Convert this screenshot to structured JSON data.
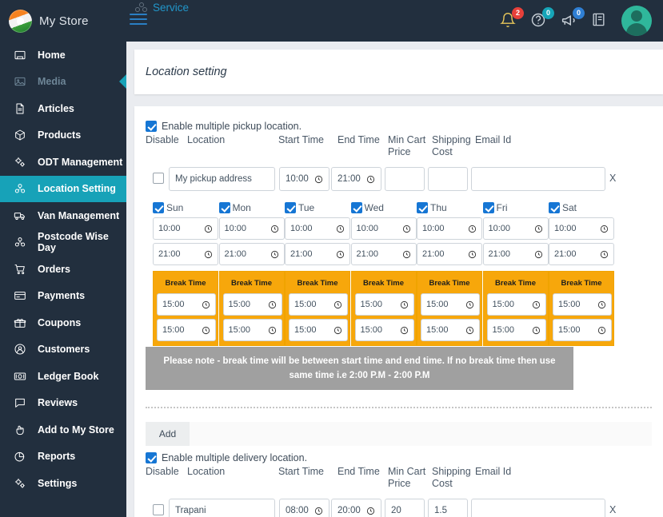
{
  "topbar": {
    "brand_name": "My Store",
    "service_tab": "Service",
    "notifications_badge": "2",
    "help_badge": "0",
    "announce_badge": "0"
  },
  "sidebar": {
    "items": [
      {
        "label": "Home",
        "icon": "home-icon",
        "state": "normal"
      },
      {
        "label": "Media",
        "icon": "media-icon",
        "state": "muted"
      },
      {
        "label": "Articles",
        "icon": "articles-icon",
        "state": "normal"
      },
      {
        "label": "Products",
        "icon": "products-icon",
        "state": "normal"
      },
      {
        "label": "ODT Management",
        "icon": "odt-icon",
        "state": "normal"
      },
      {
        "label": "Location Setting",
        "icon": "location-setting-icon",
        "state": "active"
      },
      {
        "label": "Van Management",
        "icon": "van-icon",
        "state": "normal"
      },
      {
        "label": "Postcode Wise Day",
        "icon": "postcode-icon",
        "state": "normal"
      },
      {
        "label": "Orders",
        "icon": "orders-icon",
        "state": "normal"
      },
      {
        "label": "Payments",
        "icon": "payments-icon",
        "state": "normal"
      },
      {
        "label": "Coupons",
        "icon": "coupons-icon",
        "state": "normal"
      },
      {
        "label": "Customers",
        "icon": "customers-icon",
        "state": "normal"
      },
      {
        "label": "Ledger Book",
        "icon": "ledger-icon",
        "state": "normal"
      },
      {
        "label": "Reviews",
        "icon": "reviews-icon",
        "state": "normal"
      },
      {
        "label": "Add to My Store",
        "icon": "add-to-store-icon",
        "state": "normal"
      },
      {
        "label": "Reports",
        "icon": "reports-icon",
        "state": "normal"
      },
      {
        "label": "Settings",
        "icon": "settings-icon",
        "state": "normal"
      }
    ]
  },
  "page": {
    "title": "Location setting"
  },
  "pickup": {
    "enable_label": "Enable multiple pickup location.",
    "enable_checked": true,
    "headers": {
      "disable": "Disable",
      "location": "Location",
      "start_time": "Start Time",
      "end_time": "End Time",
      "min_cart_price": "Min Cart Price",
      "shipping_cost": "Shipping Cost",
      "email_id": "Email Id"
    },
    "row": {
      "disabled_checked": false,
      "location": "My pickup address",
      "start_time": "10:00",
      "end_time": "21:00",
      "min_cart_price": "",
      "shipping_cost": "",
      "email_id": "",
      "remove_label": "X"
    },
    "days": [
      {
        "name": "Sun",
        "checked": true,
        "open": "10:00",
        "close": "21:00",
        "break_label": "Break Time",
        "break_start": "15:00",
        "break_end": "15:00"
      },
      {
        "name": "Mon",
        "checked": true,
        "open": "10:00",
        "close": "21:00",
        "break_label": "Break Time",
        "break_start": "15:00",
        "break_end": "15:00"
      },
      {
        "name": "Tue",
        "checked": true,
        "open": "10:00",
        "close": "21:00",
        "break_label": "Break Time",
        "break_start": "15:00",
        "break_end": "15:00"
      },
      {
        "name": "Wed",
        "checked": true,
        "open": "10:00",
        "close": "21:00",
        "break_label": "Break Time",
        "break_start": "15:00",
        "break_end": "15:00"
      },
      {
        "name": "Thu",
        "checked": true,
        "open": "10:00",
        "close": "21:00",
        "break_label": "Break Time",
        "break_start": "15:00",
        "break_end": "15:00"
      },
      {
        "name": "Fri",
        "checked": true,
        "open": "10:00",
        "close": "21:00",
        "break_label": "Break Time",
        "break_start": "15:00",
        "break_end": "15:00"
      },
      {
        "name": "Sat",
        "checked": true,
        "open": "10:00",
        "close": "21:00",
        "break_label": "Break Time",
        "break_start": "15:00",
        "break_end": "15:00"
      }
    ],
    "note": "Please note - break time will be between start time and end time. If no break time then use same time i.e 2:00 P.M - 2:00 P.M"
  },
  "add_button_label": "Add",
  "delivery": {
    "enable_label": "Enable multiple delivery location.",
    "enable_checked": true,
    "headers": {
      "disable": "Disable",
      "location": "Location",
      "start_time": "Start Time",
      "end_time": "End Time",
      "min_cart_price": "Min Cart Price",
      "shipping_cost": "Shipping Cost",
      "email_id": "Email Id"
    },
    "row": {
      "disabled_checked": false,
      "location": "Trapani",
      "start_time": "08:00",
      "end_time": "20:00",
      "min_cart_price": "20",
      "shipping_cost": "1.5",
      "email_id": "",
      "remove_label": "X"
    }
  },
  "colors": {
    "sidebar_bg": "#222f3e",
    "accent_teal": "#17a2b8",
    "checkbox_blue": "#1676d4",
    "break_orange": "#f7a70b",
    "note_gray": "#a0a0a0"
  }
}
